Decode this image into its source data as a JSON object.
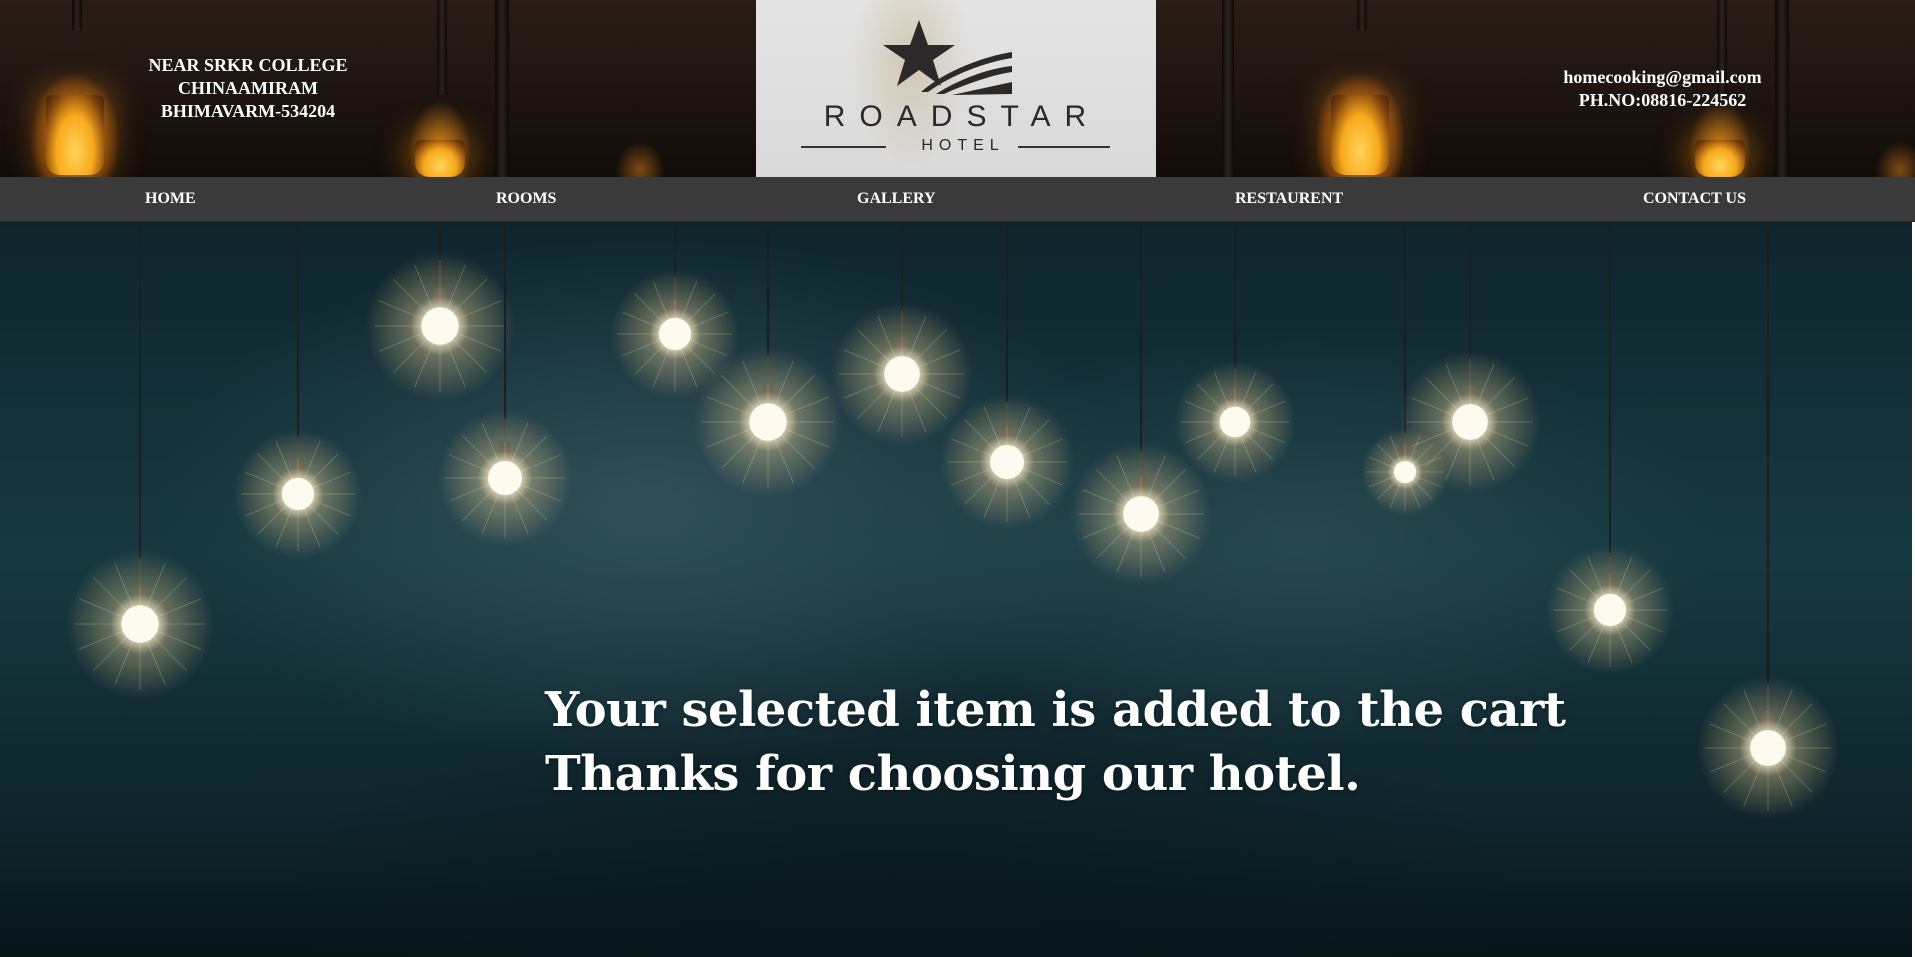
{
  "header": {
    "address_lines": [
      "NEAR SRKR COLLEGE",
      "CHINAAMIRAM",
      "BHIMAVARM-534204"
    ],
    "email": "homecooking@gmail.com",
    "phone": "PH.NO:08816-224562",
    "logo": {
      "brand": "ROADSTAR",
      "sub": "HOTEL",
      "icon": "star-icon"
    }
  },
  "nav": {
    "items": [
      {
        "label": "HOME"
      },
      {
        "label": "ROOMS"
      },
      {
        "label": "GALLERY"
      },
      {
        "label": "RESTAURENT"
      },
      {
        "label": "CONTACT US"
      }
    ]
  },
  "main": {
    "message_line1": "Your selected item is added to the cart",
    "message_line2": "Thanks for choosing our hotel."
  },
  "colors": {
    "nav_bg": "#3a3a3a",
    "text": "#ffffff",
    "logo_bg": "#dcdcdc",
    "hero_bg": "#173840"
  }
}
